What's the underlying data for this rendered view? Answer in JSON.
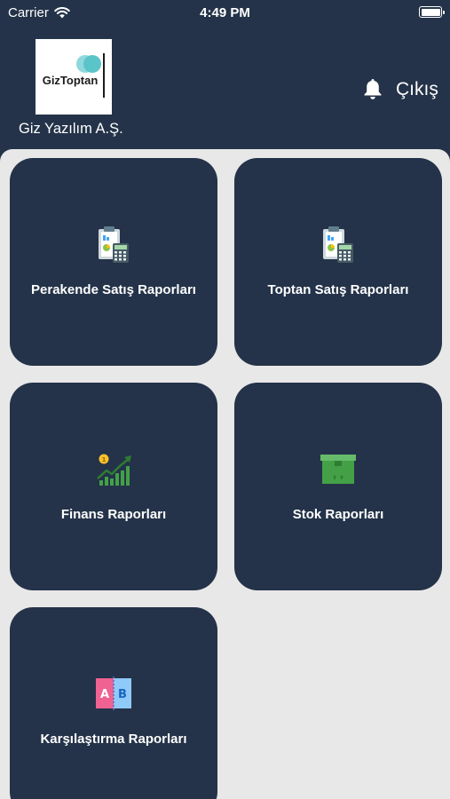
{
  "status_bar": {
    "carrier": "Carrier",
    "time": "4:49 PM"
  },
  "header": {
    "logo_text": "GizToptan",
    "company_name": "Giz Yazılım A.Ş.",
    "logout_label": "Çıkış",
    "icons": {
      "notification": "bell-icon"
    }
  },
  "colors": {
    "primary": "#243349",
    "background": "#e8e8e8",
    "logo_teal": "#5bc4c9",
    "logo_teal_light": "#8fd8dc"
  },
  "menu": [
    {
      "label": "Perakende Satış Raporları",
      "icon": "report-calculator-icon"
    },
    {
      "label": "Toptan Satış Raporları",
      "icon": "report-calculator-icon"
    },
    {
      "label": "Finans Raporları",
      "icon": "finance-growth-icon"
    },
    {
      "label": "Stok Raporları",
      "icon": "stock-box-icon"
    },
    {
      "label": "Karşılaştırma Raporları",
      "icon": "compare-ab-icon"
    }
  ]
}
